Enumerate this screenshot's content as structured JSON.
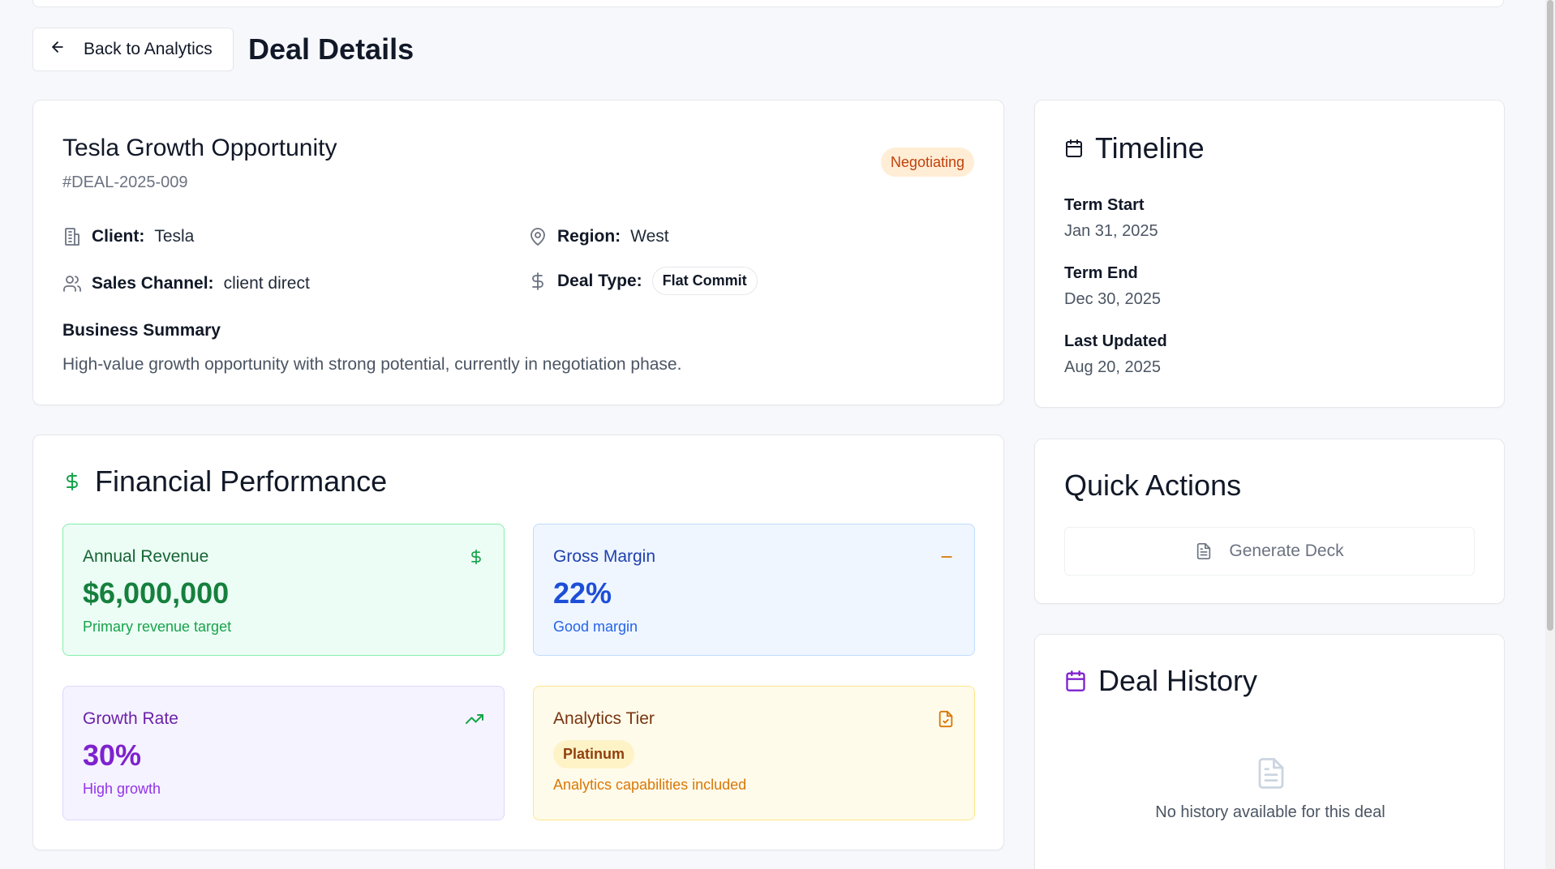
{
  "header": {
    "back_label": "Back to Analytics",
    "title": "Deal Details"
  },
  "deal": {
    "name": "Tesla Growth Opportunity",
    "id": "#DEAL-2025-009",
    "status": "Negotiating",
    "client_label": "Client:",
    "client": "Tesla",
    "region_label": "Region:",
    "region": "West",
    "channel_label": "Sales Channel:",
    "channel": "client direct",
    "type_label": "Deal Type:",
    "type": "Flat Commit",
    "summary_title": "Business Summary",
    "summary": "High-value growth opportunity with strong potential, currently in negotiation phase."
  },
  "timeline": {
    "title": "Timeline",
    "items": [
      {
        "label": "Term Start",
        "value": "Jan 31, 2025"
      },
      {
        "label": "Term End",
        "value": "Dec 30, 2025"
      },
      {
        "label": "Last Updated",
        "value": "Aug 20, 2025"
      }
    ]
  },
  "quick_actions": {
    "title": "Quick Actions",
    "generate_label": "Generate Deck"
  },
  "history": {
    "title": "Deal History",
    "empty_text": "No history available for this deal"
  },
  "financial": {
    "title": "Financial Performance",
    "revenue": {
      "label": "Annual Revenue",
      "value": "$6,000,000",
      "sub": "Primary revenue target"
    },
    "margin": {
      "label": "Gross Margin",
      "value": "22%",
      "sub": "Good margin"
    },
    "growth": {
      "label": "Growth Rate",
      "value": "30%",
      "sub": "High growth"
    },
    "tier": {
      "label": "Analytics Tier",
      "value": "Platinum",
      "sub": "Analytics capabilities included"
    }
  },
  "colors": {
    "status_bg": "#ffedd5",
    "status_text": "#c2410c",
    "green": "#15803d",
    "blue": "#1d4ed8",
    "purple": "#7e22ce",
    "amber": "#92400e"
  },
  "icons": [
    "arrow-left-icon",
    "building-icon",
    "map-pin-icon",
    "users-icon",
    "dollar-icon",
    "calendar-icon",
    "file-icon",
    "trending-up-icon",
    "minus-icon",
    "file-check-icon"
  ]
}
